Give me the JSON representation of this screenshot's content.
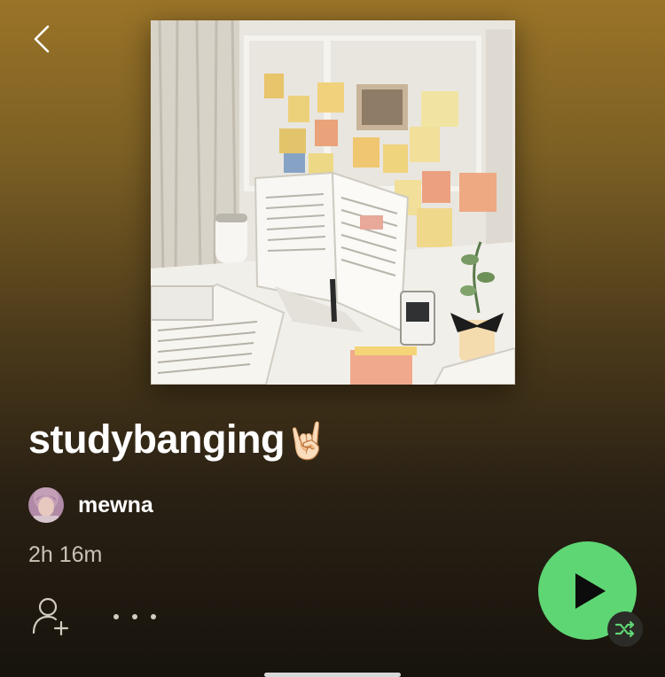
{
  "header": {
    "back_icon": "chevron-left-icon"
  },
  "playlist": {
    "cover_image": "study desk with open book and sticky notes on wall",
    "title": "studybanging",
    "title_emoji": "🤘🏻",
    "owner": {
      "name": "mewna",
      "avatar": "profile-avatar"
    },
    "duration": "2h 16m"
  },
  "actions": {
    "follow_icon": "add-user-icon",
    "more_icon": "more-options-icon",
    "play_icon": "play-icon",
    "shuffle_icon": "shuffle-icon"
  },
  "colors": {
    "background_top": "#9a7428",
    "background_bottom": "#17130d",
    "play_button": "#5fd674",
    "shuffle_button": "#2b2b27",
    "shuffle_glyph": "#5fd674",
    "secondary_text": "#c9c2b4"
  }
}
